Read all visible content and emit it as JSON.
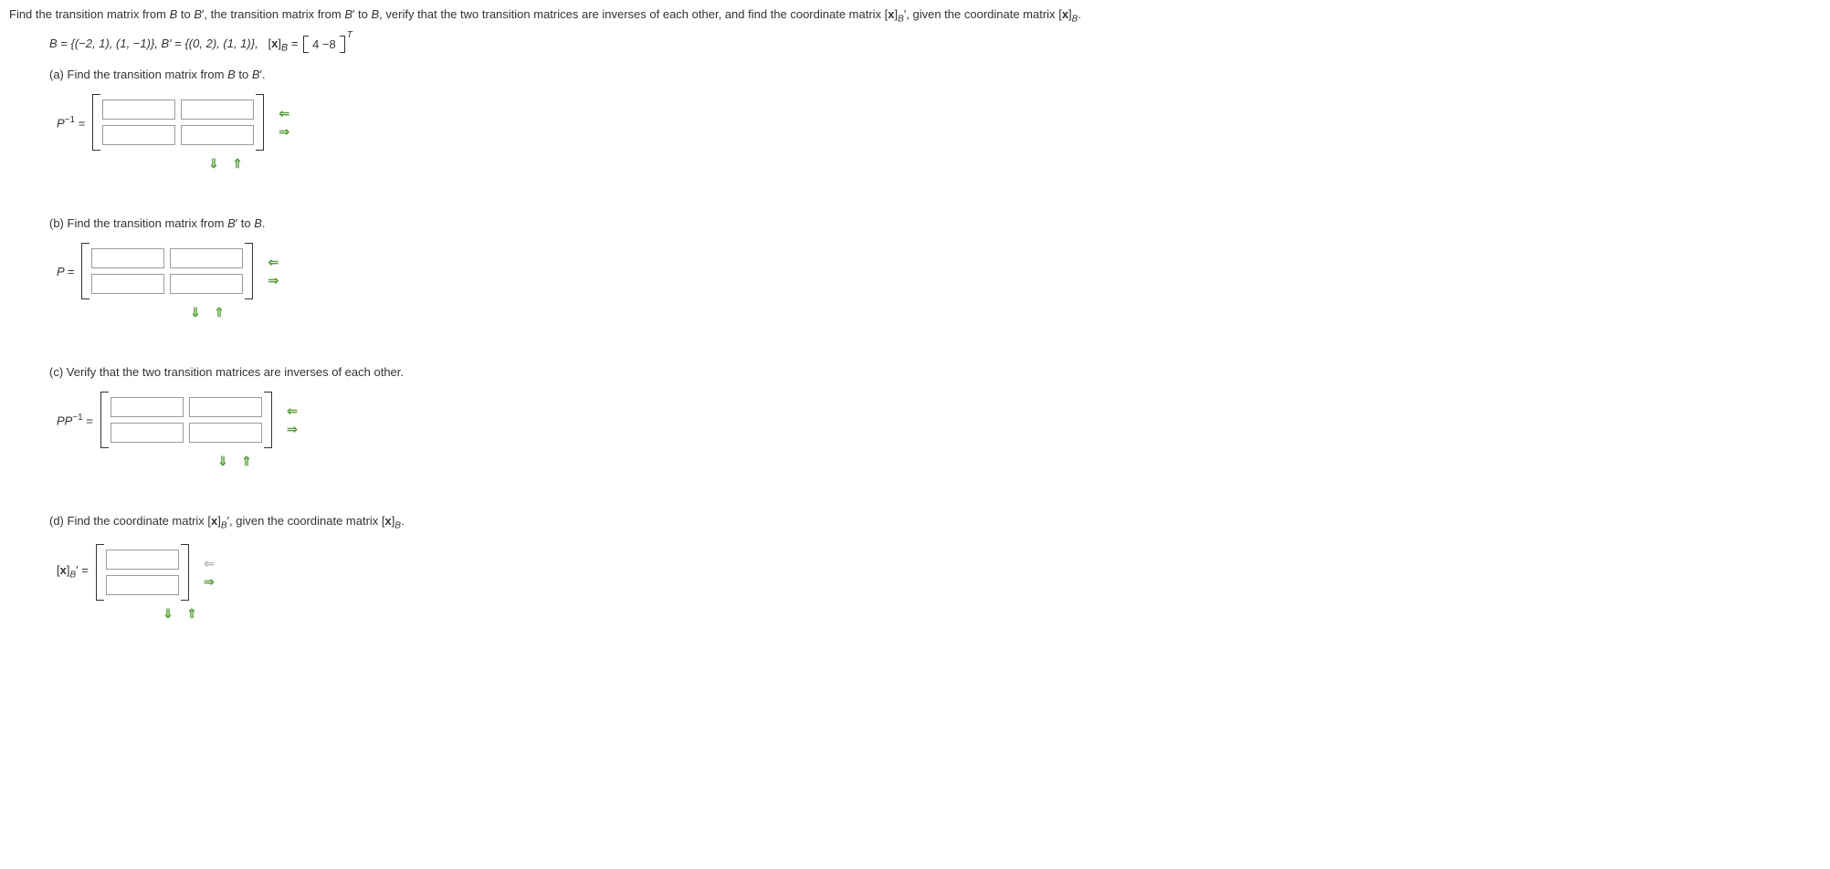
{
  "intro": {
    "text_parts": [
      "Find the transition matrix from ",
      "B",
      " to ",
      "B′",
      ", the transition matrix from ",
      "B′",
      " to ",
      "B",
      ", verify that the two transition matrices are inverses of each other, and find the coordinate matrix ",
      "[x]_B′",
      ", given the coordinate matrix ",
      "[x]_B",
      "."
    ]
  },
  "given": {
    "B_set": "{(−2, 1), (1, −1)}",
    "Bp_set": "{(0, 2), (1, 1)}",
    "xB_label": "[x]_B",
    "xB_values": "4  −8",
    "transpose": "T"
  },
  "parts": {
    "a": {
      "label": "(a) Find the transition matrix from B to B′.",
      "lhs": "P⁻¹ =",
      "rows": 2,
      "cols": 2
    },
    "b": {
      "label": "(b) Find the transition matrix from B′ to B.",
      "lhs": "P =",
      "rows": 2,
      "cols": 2
    },
    "c": {
      "label": "(c) Verify that the two transition matrices are inverses of each other.",
      "lhs": "PP⁻¹ =",
      "rows": 2,
      "cols": 2
    },
    "d": {
      "label": "(d) Find the coordinate matrix [x]_B′, given the coordinate matrix [x]_B.",
      "lhs": "[x]_B′ =",
      "rows": 2,
      "cols": 1
    }
  },
  "arrows": {
    "left": "⇐",
    "right": "⇒",
    "down": "⇓",
    "up": "⇑"
  }
}
